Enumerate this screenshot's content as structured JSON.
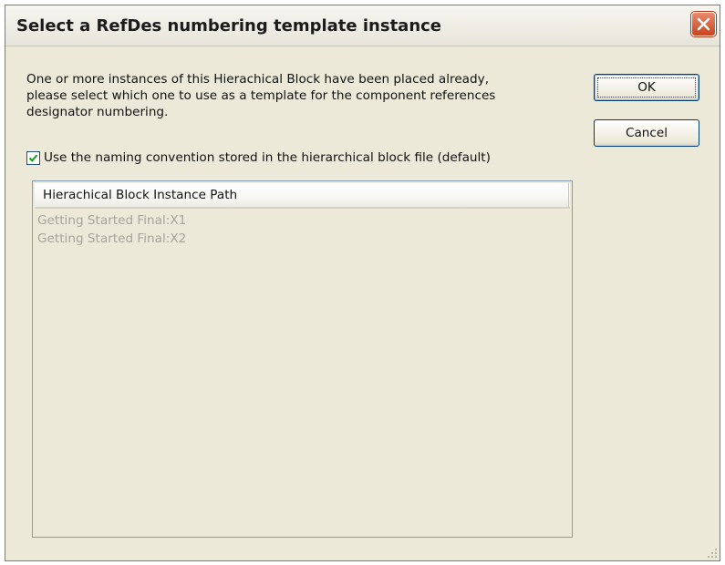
{
  "window": {
    "title": "Select a RefDes numbering template instance"
  },
  "dialog": {
    "message": "One or more instances of this Hierachical Block have been placed already,\nplease select which one to use as a template for the component references\ndesignator numbering.",
    "checkbox": {
      "label": "Use the naming convention stored in the hierarchical block file (default)",
      "checked": true
    },
    "buttons": {
      "ok": "OK",
      "cancel": "Cancel"
    }
  },
  "list": {
    "column_header": "Hierachical Block Instance Path",
    "rows": [
      {
        "path": "Getting Started Final:X1"
      },
      {
        "path": "Getting Started Final:X2"
      }
    ]
  },
  "colors": {
    "close_button": "#d5552b",
    "checkmark": "#21a121",
    "disabled_text": "#a6a49b",
    "dialog_background": "#ece9d8"
  },
  "icons": {
    "close": "close-icon",
    "checkmark": "checkmark-icon",
    "resize_grip": "resize-grip-icon"
  }
}
